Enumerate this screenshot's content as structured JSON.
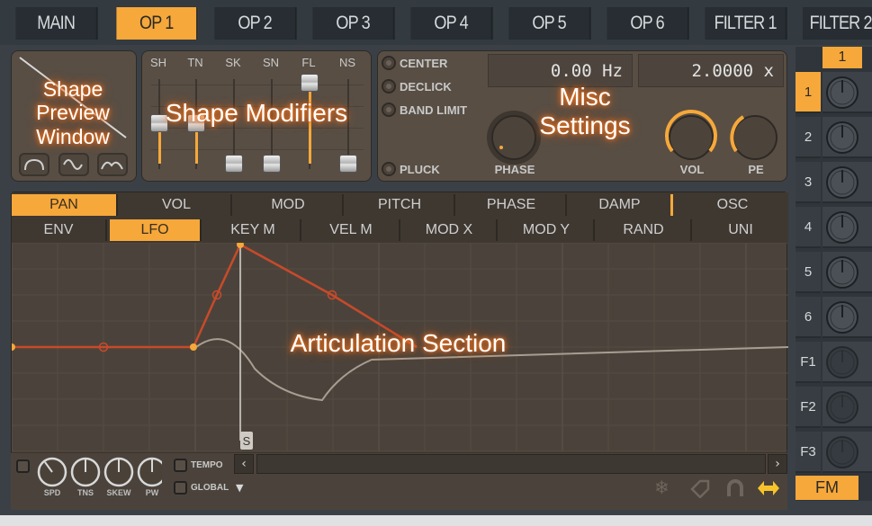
{
  "top_tabs": [
    "MAIN",
    "OP 1",
    "OP 2",
    "OP 3",
    "OP 4",
    "OP 5",
    "OP 6",
    "FILTER 1",
    "FILTER 2"
  ],
  "active_top_tab": "OP 1",
  "annotations": {
    "shape_preview": "Shape Preview Window",
    "shape_modifiers": "Shape Modifiers",
    "misc_settings": "Misc Settings",
    "articulation": "Articulation Section"
  },
  "shape_modifiers": {
    "labels": [
      "SH",
      "TN",
      "SK",
      "SN",
      "FL",
      "NS"
    ],
    "levels": [
      0.5,
      0.5,
      0.0,
      0.0,
      1.0,
      0.0
    ]
  },
  "misc": {
    "radio_options": [
      "CENTER",
      "DECLICK",
      "BAND LIMIT",
      "PLUCK"
    ],
    "frequency_value": "0.00 Hz",
    "ratio_value": "2.0000 x",
    "knobs": [
      "PHASE",
      "VOL",
      "PE"
    ]
  },
  "articulation": {
    "row1_tabs": [
      "PAN",
      "VOL",
      "MOD",
      "PITCH",
      "PHASE",
      "DAMP",
      "OSC"
    ],
    "row1_active": "PAN",
    "row2_tabs": [
      "ENV",
      "LFO",
      "KEY M",
      "VEL M",
      "MOD X",
      "MOD Y",
      "RAND",
      "UNI"
    ],
    "row2_active": "LFO",
    "sustain_marker": "S",
    "bottom_knobs": [
      "SPD",
      "TNS",
      "SKEW",
      "PW"
    ],
    "checkboxes": [
      "TEMPO",
      "GLOBAL"
    ]
  },
  "right_column": {
    "header_button": "1",
    "rows": [
      "1",
      "2",
      "3",
      "4",
      "5",
      "6",
      "F1",
      "F2",
      "F3"
    ],
    "active_row": "1",
    "footer_button": "FM"
  },
  "colors": {
    "accent": "#f6a83a",
    "envelope_line": "#c84a2a",
    "panel": "#584e44",
    "background": "#3a4046"
  }
}
